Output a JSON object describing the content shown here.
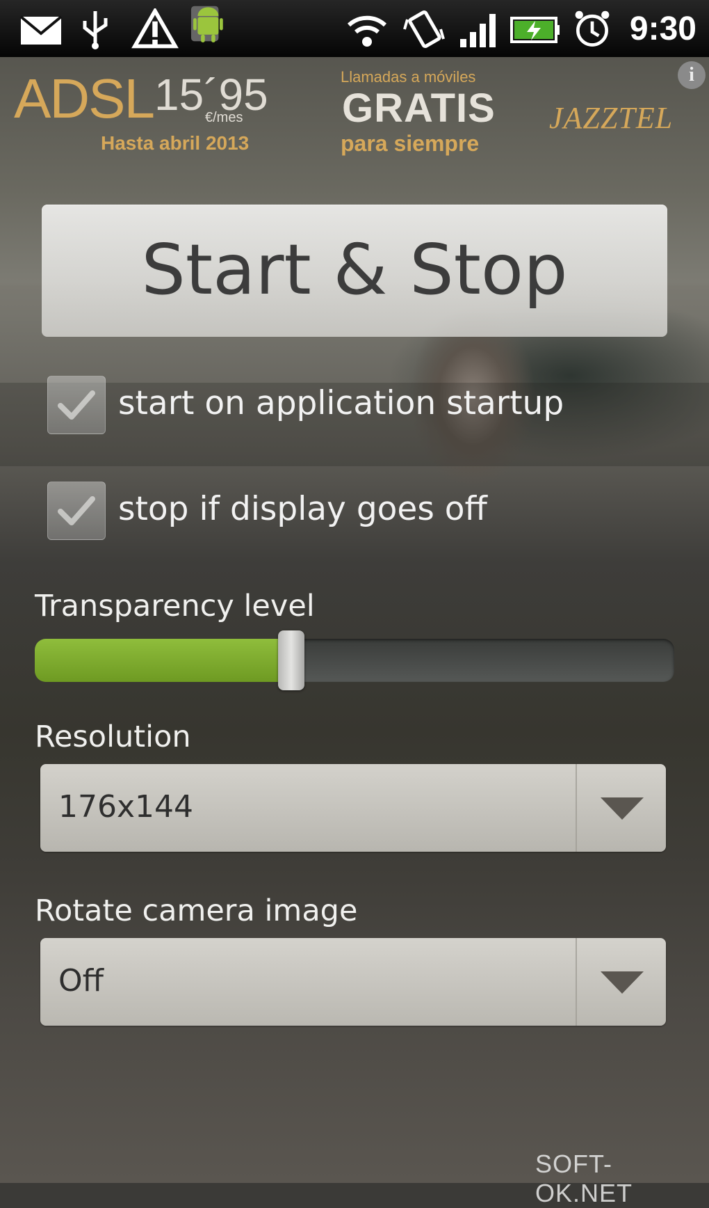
{
  "status_bar": {
    "time": "9:30",
    "icons": [
      "mail-icon",
      "usb-icon",
      "warning-icon",
      "android-icon",
      "wifi-icon",
      "vibrate-icon",
      "signal-icon",
      "battery-charging-icon",
      "alarm-icon"
    ]
  },
  "ad": {
    "adsl": "ADSL",
    "price": "15´95",
    "price_unit": "€/mes",
    "until": "Hasta abril 2013",
    "calls": "Llamadas a móviles",
    "free": "GRATIS",
    "forever": "para siempre",
    "brand": "JAZZTEL",
    "info": "i"
  },
  "main": {
    "start_stop_label": "Start & Stop",
    "checkbox_startup_label": "start on application startup",
    "checkbox_startup_checked": true,
    "checkbox_display_label": "stop if display goes off",
    "checkbox_display_checked": true,
    "transparency_label": "Transparency level",
    "transparency_value": 0.4,
    "resolution_label": "Resolution",
    "resolution_value": "176x144",
    "rotate_label": "Rotate camera image",
    "rotate_value": "Off"
  },
  "watermark": "SOFT-OK.NET",
  "colors": {
    "slider_fill": "#8fbd3c",
    "ad_gold": "#d6a85a"
  }
}
